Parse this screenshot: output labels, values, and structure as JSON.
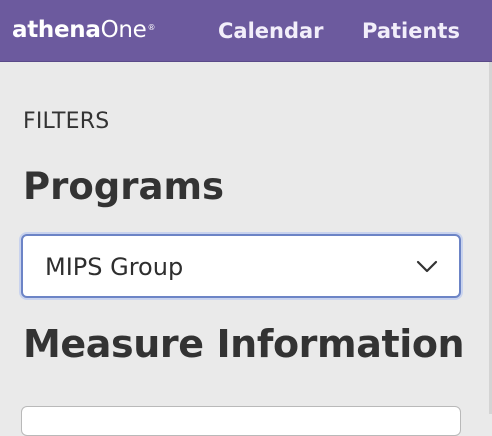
{
  "header": {
    "logo": {
      "part_bold": "athena",
      "part_regular": "One",
      "registered_mark": "®"
    },
    "nav": {
      "calendar": "Calendar",
      "patients": "Patients"
    },
    "brand_color": "#6c5a9e"
  },
  "filters": {
    "section_label": "FILTERS",
    "programs": {
      "heading": "Programs",
      "selected_value": "MIPS Group",
      "icon": "chevron-down-icon"
    },
    "measure_information": {
      "heading": "Measure Information"
    }
  }
}
